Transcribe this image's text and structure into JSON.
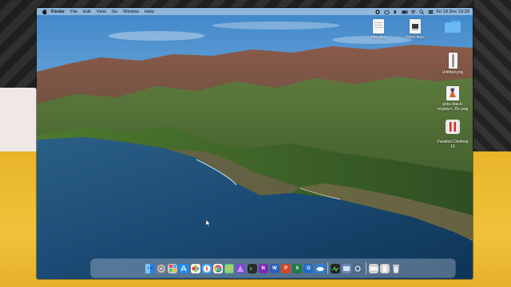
{
  "menubar": {
    "app_name": "Finder",
    "menus": [
      "File",
      "Edit",
      "View",
      "Go",
      "Window",
      "Help"
    ],
    "clock": "Fri 18 Dec 19:29"
  },
  "desktop_icons": [
    {
      "label": "File.xlsx",
      "icon": "spreadsheet-file-icon"
    },
    {
      "label": "Word.docx",
      "icon": "word-document-icon"
    },
    {
      "label": "",
      "icon": "folder-icon"
    },
    {
      "label": "Untitled.png",
      "icon": "image-file-icon"
    },
    {
      "label": "goku-black-\nvegeta-f...f5c.png",
      "icon": "image-file-icon"
    },
    {
      "label": "Parallels Desktop\n16",
      "icon": "parallels-app-icon"
    }
  ],
  "dock": {
    "apps": [
      {
        "name": "Finder",
        "color": "#2f8de4"
      },
      {
        "name": "System Preferences",
        "color": "#7d7d85"
      },
      {
        "name": "Launchpad",
        "color": "#c9c9cf"
      },
      {
        "name": "App Store",
        "color": "#1f8ef1"
      },
      {
        "name": "Photos",
        "color": "#f3f3f3"
      },
      {
        "name": "Safari",
        "color": "#3ba3f0"
      },
      {
        "name": "Chrome",
        "color": "#f1f1f1"
      },
      {
        "name": "Maps",
        "color": "#5bbf68"
      },
      {
        "name": "Affinity",
        "color": "#7b4ccf"
      },
      {
        "name": "Terminal",
        "color": "#2a2a2a"
      },
      {
        "name": "OneNote",
        "color": "#7a2bb5"
      },
      {
        "name": "Word",
        "color": "#2b5fb8"
      },
      {
        "name": "PowerPoint",
        "color": "#d24726"
      },
      {
        "name": "Excel",
        "color": "#1d7a45"
      },
      {
        "name": "Outlook",
        "color": "#1f6fc6"
      },
      {
        "name": "OneDrive",
        "color": "#2f7fd8"
      },
      {
        "name": "Activity Monitor",
        "color": "#222222"
      },
      {
        "name": "Preview",
        "color": "#6a88b0"
      },
      {
        "name": "Screenshot",
        "color": "#4a6b8c"
      },
      {
        "name": "Downloads",
        "color": "#d7d7d7"
      },
      {
        "name": "Documents",
        "color": "#d0d0d0"
      },
      {
        "name": "Trash",
        "color": "#c9c9c9"
      }
    ]
  }
}
